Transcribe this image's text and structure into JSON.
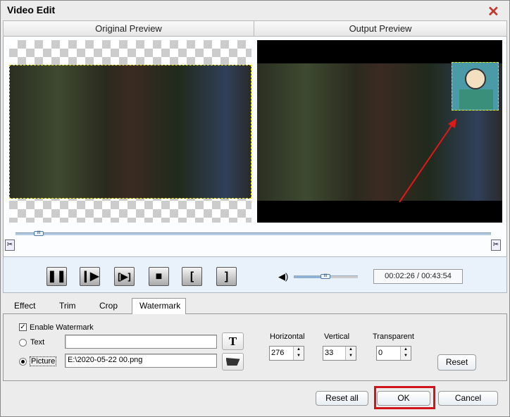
{
  "window": {
    "title": "Video Edit",
    "close_icon": "close-icon"
  },
  "preview": {
    "original_label": "Original Preview",
    "output_label": "Output Preview"
  },
  "playback": {
    "time": "00:02:26 / 00:43:54",
    "timeline_position": 0.05,
    "volume": 0.5,
    "buttons": [
      {
        "icon": "pause-icon",
        "glyph": "❚❚"
      },
      {
        "icon": "play-icon",
        "glyph": "❙▶"
      },
      {
        "icon": "play-selection-icon",
        "glyph": "[▶]"
      },
      {
        "icon": "stop-icon",
        "glyph": "■"
      },
      {
        "icon": "mark-in-icon",
        "glyph": "["
      },
      {
        "icon": "mark-out-icon",
        "glyph": "]"
      }
    ]
  },
  "tabs": [
    {
      "label": "Effect"
    },
    {
      "label": "Trim"
    },
    {
      "label": "Crop"
    },
    {
      "label": "Watermark",
      "selected": true
    }
  ],
  "watermark": {
    "enable_label": "Enable Watermark",
    "enabled": true,
    "text_label": "Text",
    "text_value": "",
    "picture_label": "Picture",
    "picture_value": "E:\\2020-05-22 00.png",
    "selected": "picture",
    "horizontal_label": "Horizontal",
    "horizontal": "276",
    "vertical_label": "Vertical",
    "vertical": "33",
    "transparent_label": "Transparent",
    "transparent": "0",
    "reset_label": "Reset"
  },
  "footer": {
    "reset_all": "Reset all",
    "ok": "OK",
    "cancel": "Cancel"
  },
  "colors": {
    "highlight": "#d0141c",
    "selection_dash": "#e8e000"
  }
}
